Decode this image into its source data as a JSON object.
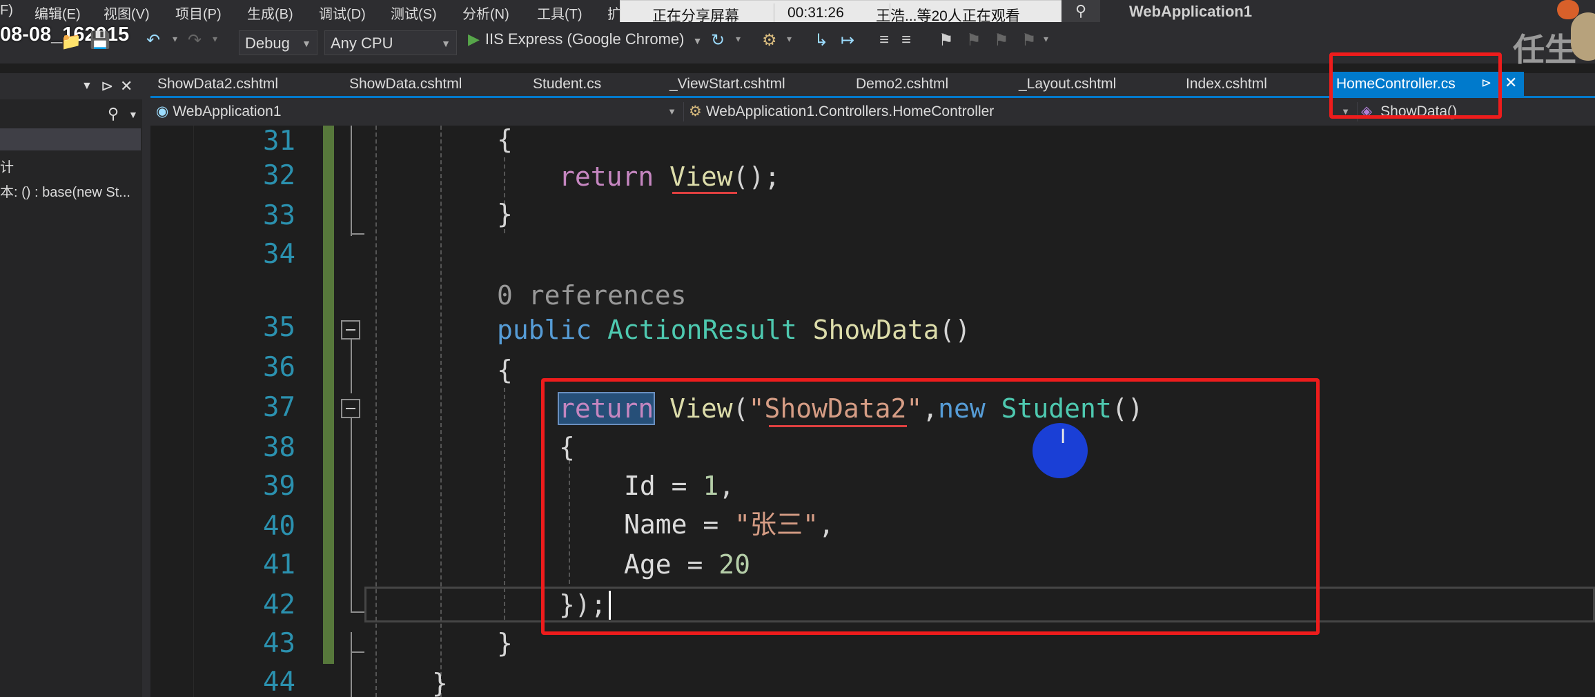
{
  "menu": {
    "items": [
      "F)",
      "编辑(E)",
      "视图(V)",
      "项目(P)",
      "生成(B)",
      "调试(D)",
      "测试(S)",
      "分析(N)",
      "工具(T)",
      "扩"
    ]
  },
  "screen_share": {
    "status": "正在分享屏幕",
    "time": "00:31:26",
    "viewers": "王浩...等20人正在观看"
  },
  "app_title": "WebApplication1",
  "recording_stamp": "08-08_162015",
  "toolbar": {
    "configuration": "Debug",
    "platform": "Any CPU",
    "run_target": "IIS Express (Google Chrome)"
  },
  "watermark": "任生",
  "left_panel": {
    "items": [
      "计",
      "本: () : base(new St..."
    ]
  },
  "tabs": [
    "ShowData2.cshtml",
    "ShowData.cshtml",
    "Student.cs",
    "_ViewStart.cshtml",
    "Demo2.cshtml",
    "_Layout.cshtml",
    "Index.cshtml"
  ],
  "active_tab": "HomeController.cs",
  "navbar": {
    "project": "WebApplication1",
    "class": "WebApplication1.Controllers.HomeController",
    "member": "ShowData()"
  },
  "editor": {
    "line_numbers": [
      "31",
      "32",
      "33",
      "34",
      "35",
      "36",
      "37",
      "38",
      "39",
      "40",
      "41",
      "42",
      "43",
      "44"
    ],
    "codelens": "0 references",
    "code": {
      "l31": "{",
      "l32_kw": "return",
      "l32_fn": "View",
      "l32_rest": "();",
      "l33": "}",
      "l35_kw": "public",
      "l35_type": "ActionResult",
      "l35_fn": "ShowData",
      "l35_rest": "()",
      "l36": "{",
      "l37_kw": "return",
      "l37_fn": "View",
      "l37_open": "(",
      "l37_str": "\"ShowData2\"",
      "l37_comma": ",",
      "l37_new": "new",
      "l37_type": "Student",
      "l37_close": "()",
      "l38": "{",
      "l39_id": "Id",
      "l39_eq": " = ",
      "l39_num": "1",
      "l39_end": ",",
      "l40_id": "Name",
      "l40_eq": " = ",
      "l40_str": "\"张三\"",
      "l40_end": ",",
      "l41_id": "Age",
      "l41_eq": " = ",
      "l41_num": "20",
      "l42": "});",
      "l43": "}",
      "l44": "}"
    }
  },
  "colors": {
    "accent": "#007acc",
    "highlight_box": "#ee1c1c",
    "cursor_marker": "#1a3fd6",
    "change_bar": "#57783b"
  }
}
